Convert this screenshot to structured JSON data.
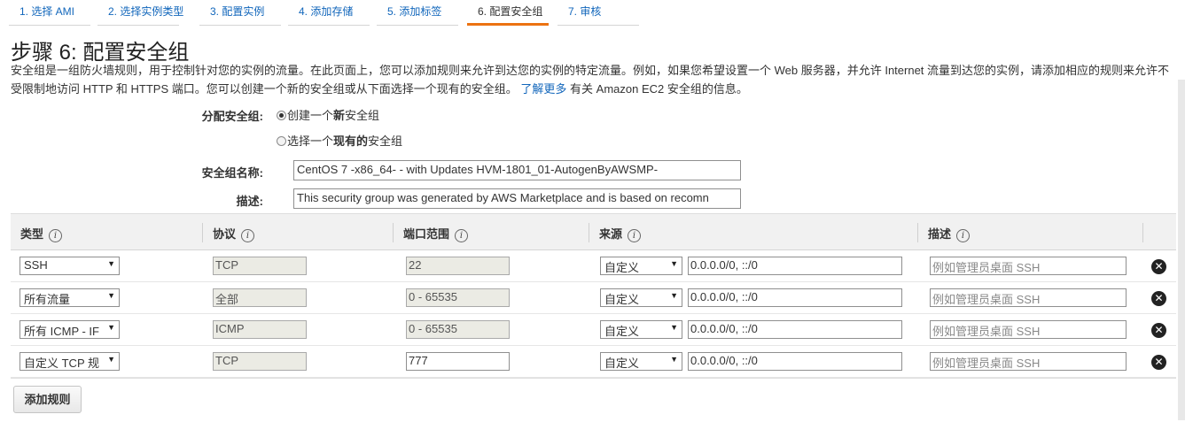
{
  "tabs": [
    {
      "label": "1. 选择 AMI"
    },
    {
      "label": "2. 选择实例类型"
    },
    {
      "label": "3. 配置实例"
    },
    {
      "label": "4. 添加存储"
    },
    {
      "label": "5. 添加标签"
    },
    {
      "label": "6. 配置安全组",
      "active": true
    },
    {
      "label": "7. 审核"
    }
  ],
  "page": {
    "title": "步骤 6: 配置安全组",
    "intro_text": "安全组是一组防火墙规则，用于控制针对您的实例的流量。在此页面上，您可以添加规则来允许到达您的实例的特定流量。例如，如果您希望设置一个 Web 服务器，并允许 Internet 流量到达您的实例，请添加相应的规则来允许不受限制地访问 HTTP 和 HTTPS 端口。您可以创建一个新的安全组或从下面选择一个现有的安全组。",
    "learn_more_link": "了解更多",
    "intro_suffix": " 有关 Amazon EC2 安全组的信息。"
  },
  "assign": {
    "label": "分配安全组:",
    "option_new_prefix": "创建一个",
    "option_new_bold": "新",
    "option_new_suffix": "安全组",
    "option_existing_prefix": "选择一个",
    "option_existing_bold": "现有的",
    "option_existing_suffix": "安全组"
  },
  "group_name": {
    "label": "安全组名称:",
    "value": "CentOS 7 -x86_64- - with Updates HVM-1801_01-AutogenByAWSMP-"
  },
  "description": {
    "label": "描述:",
    "value": "This security group was generated by AWS Marketplace and is based on recomn"
  },
  "table": {
    "headers": {
      "type": "类型",
      "protocol": "协议",
      "port_range": "端口范围",
      "source": "来源",
      "description": "描述"
    },
    "info_icon": "i",
    "rows": [
      {
        "type": "SSH",
        "protocol": "TCP",
        "port": "22",
        "port_editable": false,
        "source_type": "自定义",
        "source": "0.0.0.0/0, ::/0",
        "desc_placeholder": "例如管理员桌面 SSH"
      },
      {
        "type": "所有流量",
        "protocol": "全部",
        "port": "0 - 65535",
        "port_editable": false,
        "source_type": "自定义",
        "source": "0.0.0.0/0, ::/0",
        "desc_placeholder": "例如管理员桌面 SSH"
      },
      {
        "type": "所有 ICMP - IF",
        "protocol": "ICMP",
        "port": "0 - 65535",
        "port_editable": false,
        "source_type": "自定义",
        "source": "0.0.0.0/0, ::/0",
        "desc_placeholder": "例如管理员桌面 SSH"
      },
      {
        "type": "自定义 TCP 规",
        "protocol": "TCP",
        "port": "777",
        "port_editable": true,
        "source_type": "自定义",
        "source": "0.0.0.0/0, ::/0",
        "desc_placeholder": "例如管理员桌面 SSH"
      }
    ],
    "delete_glyph": "✕"
  },
  "add_rule_button": "添加规则",
  "icons": {
    "dropdown": "chevron-down-icon",
    "info": "info-icon",
    "delete": "close-circle-icon"
  },
  "colors": {
    "link": "#1166bb",
    "active_tab_underline": "#ec7211",
    "table_header_bg": "#f1f1f1"
  }
}
